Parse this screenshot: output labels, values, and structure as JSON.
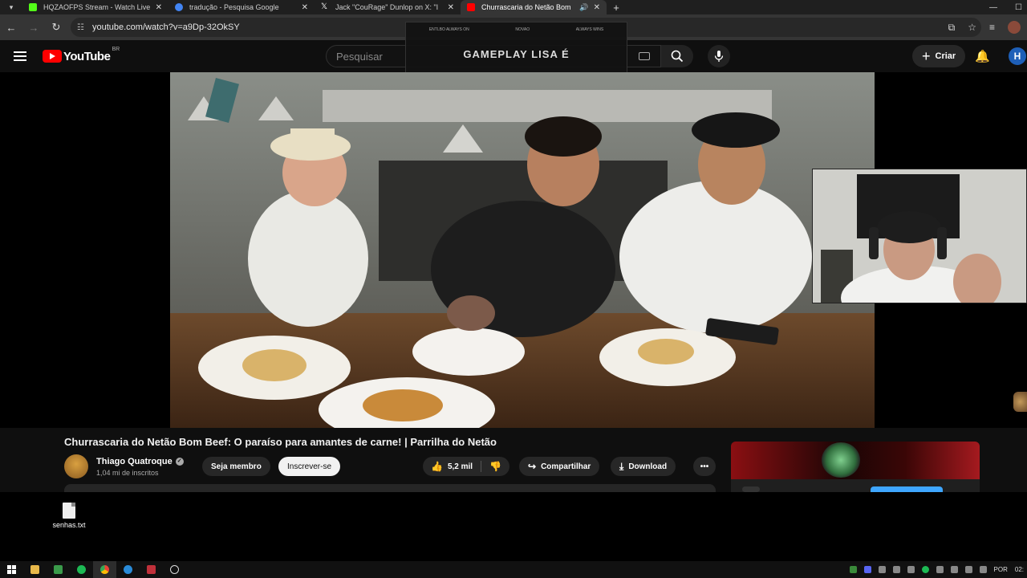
{
  "browser": {
    "tabs": [
      {
        "title": "HQZAOFPS Stream - Watch Live",
        "favicon_color": "#53fc18",
        "active": false
      },
      {
        "title": "tradução - Pesquisa Google",
        "favicon_color": "#4285f4",
        "active": false
      },
      {
        "title": "Jack \"CouRage\" Dunlop on X: \"I",
        "favicon_color": "#ffffff",
        "active": false
      },
      {
        "title": "Churrascaria do Netão Bom",
        "favicon_color": "#ff0000",
        "active": true
      }
    ],
    "url": "youtube.com/watch?v=a9Dp-32OkSY"
  },
  "youtube": {
    "logo_text": "YouTube",
    "region": "BR",
    "search_placeholder": "Pesquisar",
    "create_label": "Criar",
    "avatar_letter": "H"
  },
  "stream_overlay": {
    "mini_labels": [
      "ENTLBO ALWAYS ON",
      "NOVAO",
      "ALWAYS WINS"
    ],
    "headline": "GAMEPLAY LISA É"
  },
  "video": {
    "title": "Churrascaria do Netão Bom Beef: O paraíso para amantes de carne! | Parrilha do Netão",
    "channel_name": "Thiago Quatroque",
    "subscribers": "1,04 mi de inscritos",
    "member_label": "Seja membro",
    "subscribe_label": "Inscrever-se",
    "likes": "5,2 mil",
    "share_label": "Compartilhar",
    "download_label": "Download"
  },
  "desktop": {
    "file_label": "senhas.txt"
  },
  "taskbar": {
    "language": "POR",
    "clock": "02:"
  },
  "colors": {
    "youtube_red": "#ff0000",
    "accent_blue": "#3ea6ff",
    "header_bg": "#0f0f0f"
  }
}
